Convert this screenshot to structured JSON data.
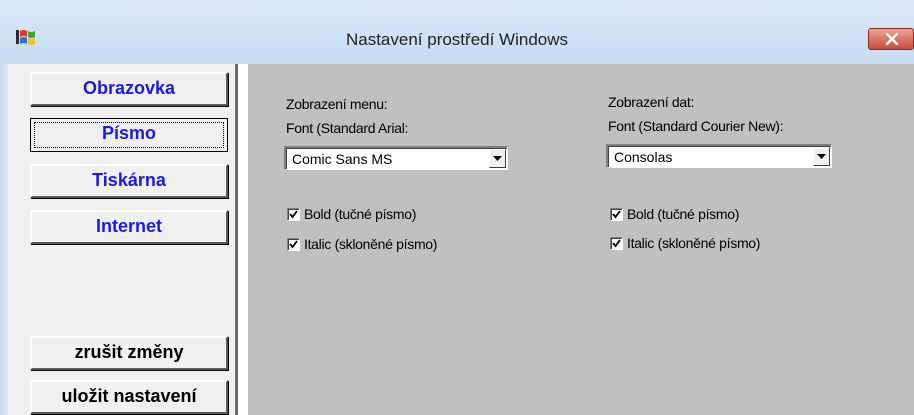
{
  "window": {
    "title": "Nastavení prostředí Windows",
    "app_icon": "windows-flag-icon",
    "close_icon": "close-icon"
  },
  "nav": {
    "items": [
      {
        "label": "Obrazovka",
        "active": false
      },
      {
        "label": "Písmo",
        "active": true
      },
      {
        "label": "Tiskárna",
        "active": false
      },
      {
        "label": "Internet",
        "active": false
      }
    ],
    "discard_label": "zrušit změny",
    "save_label": "uložit nastavení"
  },
  "menu_font": {
    "heading": "Zobrazení menu:",
    "font_label": "Font (Standard Arial:",
    "selected_font": "Comic Sans MS",
    "bold_label": "Bold (tučné písmo)",
    "bold_checked": true,
    "italic_label": "Italic (skloněné písmo)",
    "italic_checked": true
  },
  "data_font": {
    "heading": "Zobrazení dat:",
    "font_label": "Font (Standard Courier New):",
    "selected_font": "Consolas",
    "bold_label": "Bold (tučné písmo)",
    "bold_checked": true,
    "italic_label": "Italic (skloněné písmo)",
    "italic_checked": true
  },
  "colors": {
    "nav_text": "#1a1ae6",
    "panel_bg": "#c0c0c0",
    "title_bar": "#dbe9f8"
  }
}
